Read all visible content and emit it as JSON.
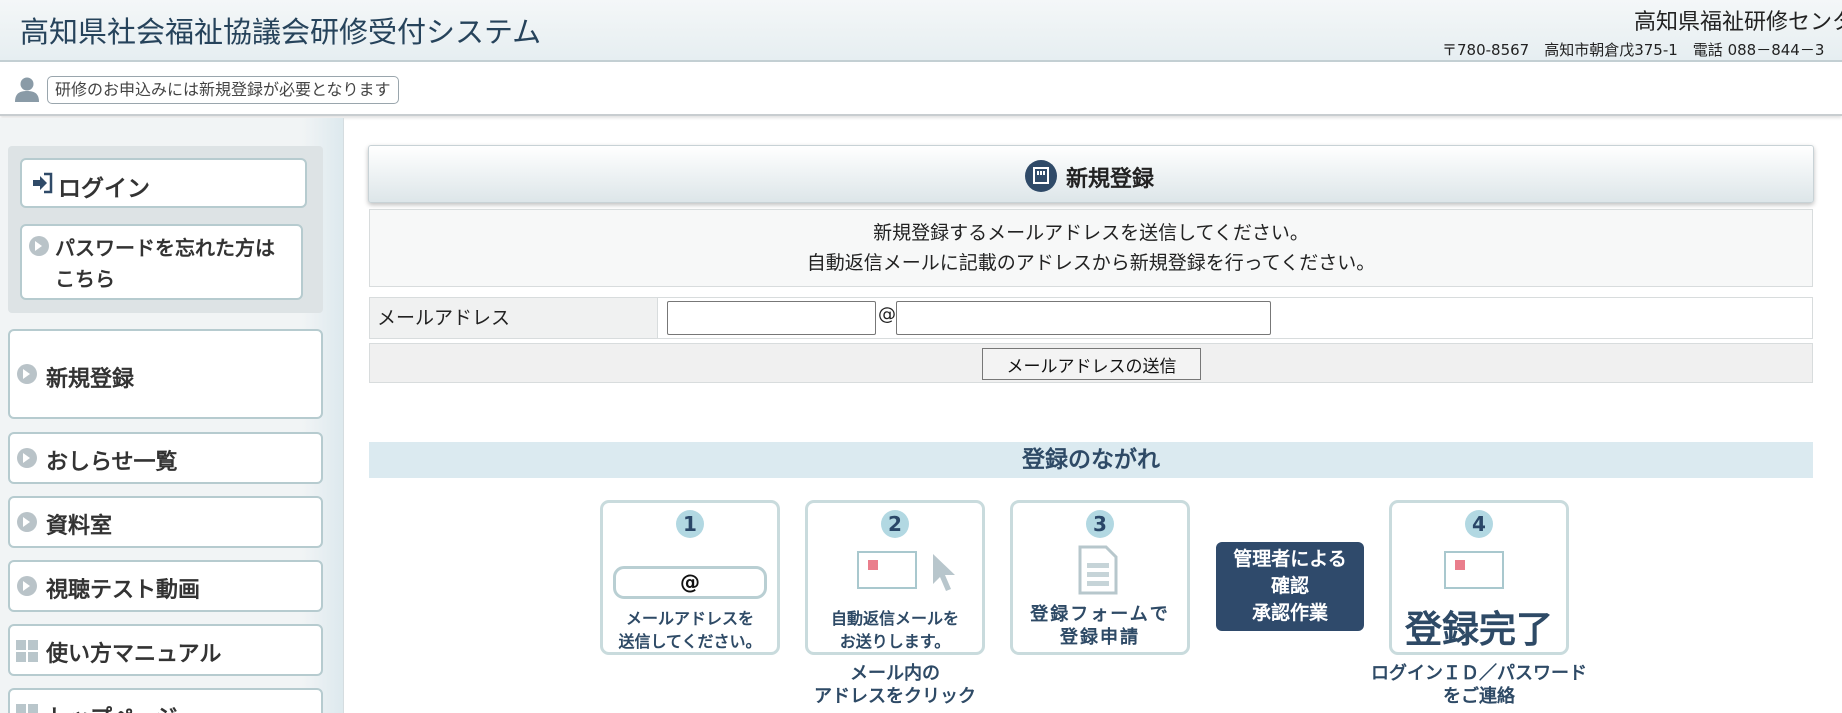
{
  "header": {
    "app_title": "高知県社会福祉協議会研修受付システム",
    "org_name": "高知県福祉研修センタ",
    "org_address": "〒780-8567　高知市朝倉戊375-1　電話 088－844－3"
  },
  "notice": {
    "text": "研修のお申込みには新規登録が必要となります",
    "icon": "user-icon"
  },
  "sidebar": {
    "login_label": "ログイン",
    "forgot_password_lines": [
      "パスワードを忘れた方は",
      "こちら"
    ],
    "items": [
      {
        "label": "新規登録",
        "icon": "arrow-circle-icon"
      },
      {
        "label": "おしらせ一覧",
        "icon": "arrow-circle-icon"
      },
      {
        "label": "資料室",
        "icon": "arrow-circle-icon"
      },
      {
        "label": "視聴テスト動画",
        "icon": "arrow-circle-icon"
      },
      {
        "label": "使い方マニュアル",
        "icon": "grid-icon"
      },
      {
        "label": "トップページ",
        "icon": "grid-icon"
      }
    ]
  },
  "main": {
    "panel_title": "新規登録",
    "instructions": [
      "新規登録するメールアドレスを送信してください。",
      "自動返信メールに記載のアドレスから新規登録を行ってください。"
    ],
    "email_label": "メールアドレス",
    "email_local_value": "",
    "email_domain_value": "",
    "at_sign": "@",
    "submit_label": "メールアドレスの送信",
    "flow_title": "登録のながれ",
    "steps": [
      {
        "num": "1",
        "icon_text": "@",
        "caption": [
          "メールアドレスを",
          "送信してください。"
        ]
      },
      {
        "num": "2",
        "caption": [
          "自動返信メールを",
          "お送りします。"
        ],
        "below": [
          "メール内の",
          "アドレスをクリック"
        ]
      },
      {
        "num": "3",
        "caption": [
          "登録フォームで",
          "登録申請"
        ]
      },
      {
        "admin": [
          "管理者による",
          "確認",
          "承認作業"
        ]
      },
      {
        "num": "4",
        "big_text": "登録完了",
        "below": [
          "ログインＩＤ／パスワード",
          "をご連絡"
        ]
      }
    ]
  },
  "colors": {
    "navy": "#2f4a6b",
    "heading_text": "#2e4a66",
    "flow_bar_bg": "#dbeaf0",
    "card_border": "#c9dbdd",
    "step_badge": "#b2d8e2",
    "mail_marker": "#ea7e8c"
  }
}
